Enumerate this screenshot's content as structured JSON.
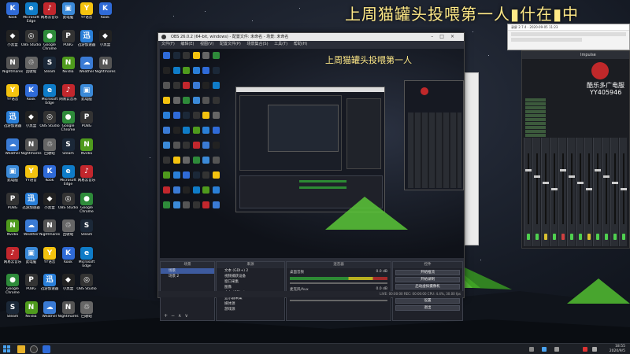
{
  "banner_text": "上周猫罐头投喂第一人",
  "banner_tail": "什在",
  "banner_end": "中",
  "nested_banner": "上周猫罐头投喂第一人",
  "obs": {
    "title": "OBS 26.0.2 (64-bit, windows) - 配置文件: 未命名 - 场景: 未命名",
    "menu": [
      "文件(F)",
      "编辑(E)",
      "视图(V)",
      "配置文件(P)",
      "场景集合(S)",
      "工具(T)",
      "帮助(H)"
    ],
    "docks": {
      "scenes_title": "场景",
      "scenes": [
        "场景",
        "场景 2"
      ],
      "sources_title": "来源",
      "sources": [
        "文本 (GDI+) 2",
        "视频捕获设备",
        "窗口采集",
        "图像",
        "文本 (GDI+)",
        "显示器采集",
        "媒体源",
        "游戏源"
      ],
      "mixer_title": "混音器",
      "mixer": [
        {
          "name": "桌面音频",
          "level": "0.0 dB"
        },
        {
          "name": "麦克风/Aux",
          "level": "0.0 dB"
        }
      ],
      "transitions_title": "转场特效",
      "controls_title": "控件",
      "controls": [
        "开始推流",
        "开始录制",
        "启动虚拟摄像机",
        "工作室模式",
        "设置",
        "退出"
      ]
    },
    "status": "LIVE: 00:00:00   REC: 00:00:00   CPU: 4.4%, 30.00 fps"
  },
  "mixer_app": {
    "brand": "酷乐多广电服",
    "qq": "YY405946",
    "header_text": "Impulse"
  },
  "tiny_window": {
    "title": "录屏 2.7.4 - 2020-09-05 11:23"
  },
  "desktop_icons": [
    {
      "label": "Kook",
      "color": "#2f6bd8",
      "glyph": "K"
    },
    {
      "label": "小黑盒",
      "color": "#222",
      "glyph": "◆"
    },
    {
      "label": "Nightmares",
      "color": "#555",
      "glyph": "N"
    },
    {
      "label": "YY语音",
      "color": "#f4c30f",
      "glyph": "Y"
    },
    {
      "label": "迅游加速器",
      "color": "#2a7fd8",
      "glyph": "迅"
    },
    {
      "label": "Weather",
      "color": "#3a7bd5",
      "glyph": "☁"
    },
    {
      "label": "此电脑",
      "color": "#3b8ad8",
      "glyph": "▣"
    },
    {
      "label": "PUBG",
      "color": "#333",
      "glyph": "P"
    },
    {
      "label": "Nvidia",
      "color": "#4f9b1d",
      "glyph": "N"
    },
    {
      "label": "网易云音乐",
      "color": "#c2272d",
      "glyph": "♪"
    },
    {
      "label": "Google Chrome",
      "color": "#2e8b3a",
      "glyph": "●"
    },
    {
      "label": "Steam",
      "color": "#1b2838",
      "glyph": "S"
    },
    {
      "label": "Microsoft Edge",
      "color": "#0f7cc8",
      "glyph": "e"
    },
    {
      "label": "OBS Studio",
      "color": "#333",
      "glyph": "◎"
    },
    {
      "label": "回收站",
      "color": "#666",
      "glyph": "♲"
    }
  ],
  "taskbar": {
    "time": "18:55",
    "date": "2020/9/5"
  }
}
